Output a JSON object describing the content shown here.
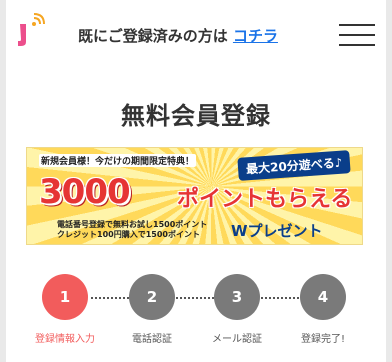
{
  "header": {
    "login_prompt": "既にご登録済みの方は",
    "login_link": "コチラ",
    "menu_icon": "hamburger-menu-icon",
    "logo_icon": "app-logo-icon"
  },
  "page": {
    "title": "無料会員登録"
  },
  "banner": {
    "tag": "新規会員様！今だけの期間限定特典！",
    "max20": "最大20分遊べる♪",
    "big_number": "3000",
    "big_suffix": "ポイントもらえる",
    "line1": "電話番号登録で無料お試し1500ポイント",
    "line2": "クレジット100円購入で1500ポイント",
    "present": "Wプレゼント"
  },
  "steps": [
    {
      "number": "1",
      "label": "登録情報入力"
    },
    {
      "number": "2",
      "label": "電話認証"
    },
    {
      "number": "3",
      "label": "メール認証"
    },
    {
      "number": "4",
      "label": "登録完了!"
    }
  ],
  "colors": {
    "active": "#f25c5c",
    "inactive": "#7a7a7a",
    "link": "#1a73e8"
  }
}
